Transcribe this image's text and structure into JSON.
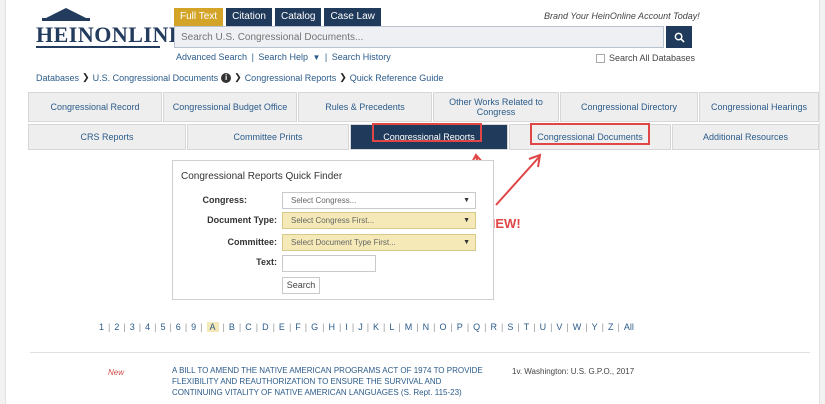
{
  "logo": {
    "text": "HeinOnline"
  },
  "search_tabs": [
    {
      "label": "Full Text",
      "active": true
    },
    {
      "label": "Citation",
      "active": false
    },
    {
      "label": "Catalog",
      "active": false
    },
    {
      "label": "Case Law",
      "active": false
    }
  ],
  "search": {
    "placeholder": "Search U.S. Congressional Documents...",
    "button_icon": "search-icon"
  },
  "brand_text": "Brand Your HeinOnline Account Today!",
  "sub_links": [
    "Advanced Search",
    "Search Help",
    "Search History"
  ],
  "search_all_label": "Search All Databases",
  "breadcrumb": [
    "Databases",
    "U.S. Congressional Documents",
    "Congressional Reports",
    "Quick Reference Guide"
  ],
  "tabs_row1": [
    "Congressional Record",
    "Congressional Budget Office",
    "Rules & Precedents",
    "Other Works Related to Congress",
    "Congressional Directory",
    "Congressional Hearings"
  ],
  "tabs_row2": [
    "CRS Reports",
    "Committee Prints",
    "Congressional Reports",
    "Congressional Documents",
    "Additional Resources"
  ],
  "active_tab": "Congressional Reports",
  "finder": {
    "title": "Congressional Reports Quick Finder",
    "congress_label": "Congress:",
    "congress_value": "Select Congress...",
    "doctype_label": "Document Type:",
    "doctype_value": "Select Congress First...",
    "committee_label": "Committee:",
    "committee_value": "Select Document Type First...",
    "text_label": "Text:",
    "search_button": "Search"
  },
  "annotation": "NEW!",
  "alpha_index": [
    "1",
    "2",
    "3",
    "4",
    "5",
    "6",
    "9",
    "A",
    "B",
    "C",
    "D",
    "E",
    "F",
    "G",
    "H",
    "I",
    "J",
    "K",
    "L",
    "M",
    "N",
    "O",
    "P",
    "Q",
    "R",
    "S",
    "T",
    "U",
    "V",
    "W",
    "Y",
    "Z",
    "All"
  ],
  "alpha_selected": "A",
  "result": {
    "badge": "New",
    "title": "A BILL TO AMEND THE NATIVE AMERICAN PROGRAMS ACT OF 1974 TO PROVIDE FLEXIBILITY AND REAUTHORIZATION TO ENSURE THE SURVIVAL AND CONTINUING VITALITY OF NATIVE AMERICAN LANGUAGES (S. Rept. 115-23)",
    "publication": "1v. Washington: U.S. G.P.O., 2017"
  },
  "colors": {
    "navy": "#1f3a5a",
    "gold": "#d3a428",
    "highlight": "#e04646",
    "link": "#2b5b8a"
  }
}
